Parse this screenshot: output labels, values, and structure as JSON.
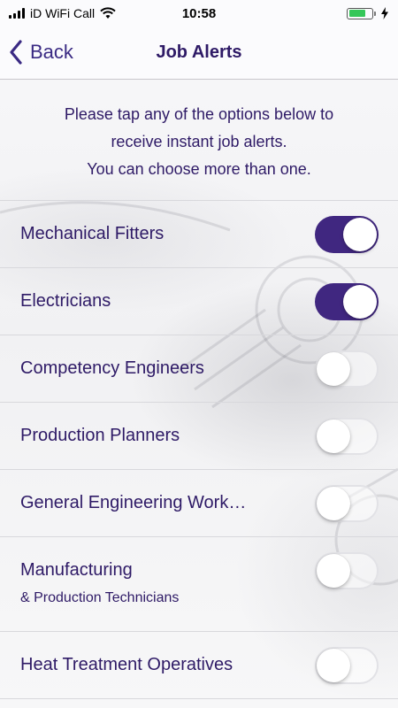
{
  "status_bar": {
    "carrier": "iD WiFi Call",
    "time": "10:58",
    "battery_level": 0.75,
    "wifi_icon": "wifi-icon",
    "charging_icon": "bolt-icon"
  },
  "nav": {
    "back_label": "Back",
    "title": "Job Alerts"
  },
  "intro": {
    "line1": "Please tap any of the options below to",
    "line2": "receive instant job alerts.",
    "line3": "You can choose more than one."
  },
  "options": [
    {
      "label": "Mechanical Fitters",
      "on": true
    },
    {
      "label": "Electricians",
      "on": true
    },
    {
      "label": "Competency Engineers",
      "on": false
    },
    {
      "label": "Production Planners",
      "on": false
    },
    {
      "label": "General Engineering Work…",
      "on": false
    },
    {
      "label": "Manufacturing",
      "sublabel": "& Production Technicians",
      "on": false
    },
    {
      "label": "Heat Treatment Operatives",
      "on": false
    }
  ],
  "colors": {
    "accent": "#402780",
    "text": "#2e1a66",
    "battery": "#35c759"
  }
}
